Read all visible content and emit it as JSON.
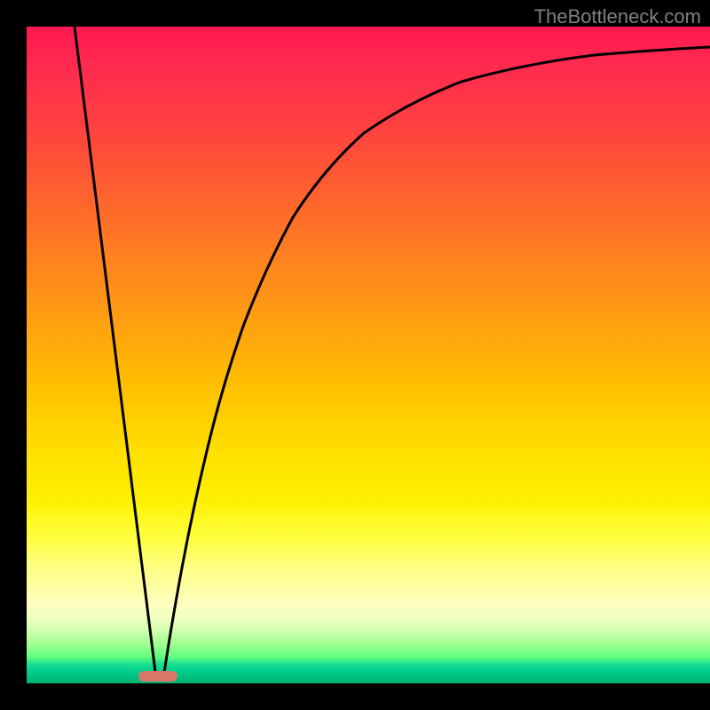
{
  "watermark": "TheBottleneck.com",
  "chart_data": {
    "type": "line",
    "title": "",
    "xlabel": "",
    "ylabel": "",
    "xlim": [
      0,
      100
    ],
    "ylim": [
      0,
      100
    ],
    "series": [
      {
        "name": "left-line",
        "x": [
          7,
          19
        ],
        "y": [
          100,
          0
        ]
      },
      {
        "name": "right-curve",
        "x": [
          20,
          22,
          25,
          28,
          32,
          37,
          43,
          50,
          58,
          68,
          80,
          100
        ],
        "y": [
          0,
          10,
          25,
          40,
          52,
          63,
          72,
          79,
          84,
          88,
          91,
          94
        ]
      }
    ],
    "marker": {
      "x_center": 19,
      "width": 6,
      "color": "#d8766a"
    },
    "gradient_colors": {
      "top": "#ff1850",
      "middle": "#ffe000",
      "bottom": "#00b070"
    }
  }
}
